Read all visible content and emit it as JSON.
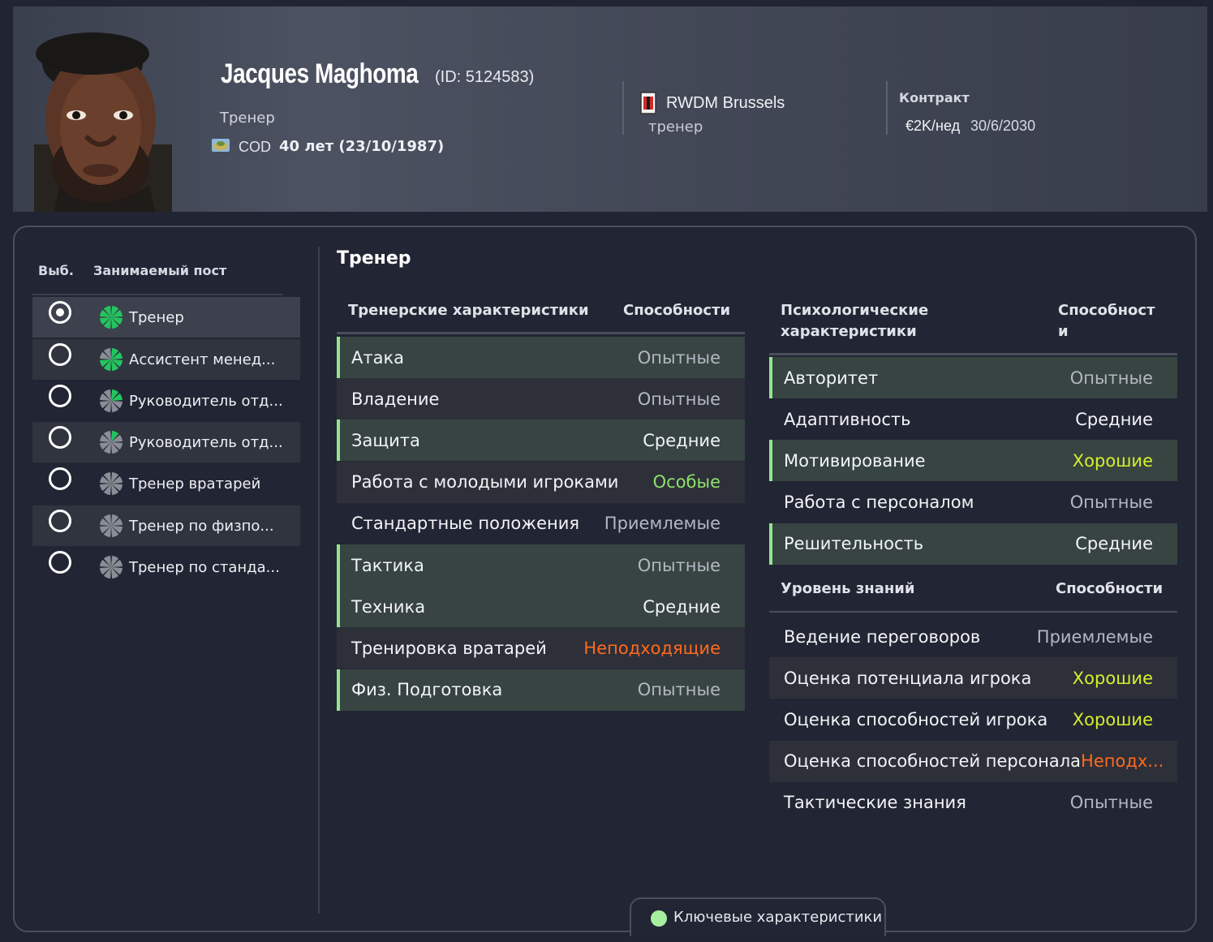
{
  "profile": {
    "name": "Jacques Maghoma",
    "id_text": "(ID: 5124583)",
    "role": "Тренер",
    "nationality": "COD",
    "age_dob": "40 лет (23/10/1987)"
  },
  "club": {
    "name": "RWDM Brussels",
    "role": "тренер"
  },
  "contract": {
    "label": "Контракт",
    "wage": "€2K/нед",
    "expiry": "30/6/2030"
  },
  "positions": {
    "header_select": "Выб.",
    "header_position": "Занимаемый пост",
    "items": [
      {
        "label": "Тренер",
        "selected": true,
        "icon": "role-pie-icon"
      },
      {
        "label": "Ассистент менед...",
        "selected": false,
        "icon": "role-pie-icon"
      },
      {
        "label": "Руководитель отд...",
        "selected": false,
        "icon": "role-pie-icon"
      },
      {
        "label": "Руководитель отд...",
        "selected": false,
        "icon": "role-pie-icon"
      },
      {
        "label": "Тренер вратарей",
        "selected": false,
        "icon": "role-pie-icon"
      },
      {
        "label": "Тренер по физпо...",
        "selected": false,
        "icon": "role-pie-icon"
      },
      {
        "label": "Тренер по станда...",
        "selected": false,
        "icon": "role-pie-icon"
      }
    ]
  },
  "section_title": "Тренер",
  "coaching": {
    "header_attr": "Тренерские характеристики",
    "header_ability": "Способности",
    "rows": [
      {
        "label": "Атака",
        "value": "Опытные",
        "key": true
      },
      {
        "label": "Владение",
        "value": "Опытные",
        "key": false
      },
      {
        "label": "Защита",
        "value": "Средние",
        "key": true
      },
      {
        "label": "Работа с молодыми игроками",
        "value": "Особые",
        "key": false
      },
      {
        "label": "Стандартные положения",
        "value": "Приемлемые",
        "key": false
      },
      {
        "label": "Тактика",
        "value": "Опытные",
        "key": true
      },
      {
        "label": "Техника",
        "value": "Средние",
        "key": true
      },
      {
        "label": "Тренировка вратарей",
        "value": "Неподходящие",
        "key": false
      },
      {
        "label": "Физ. Подготовка",
        "value": "Опытные",
        "key": true
      }
    ]
  },
  "mental": {
    "header_attr_line1": "Психологические",
    "header_attr_line2": "характеристики",
    "header_ability_line1": "Способност",
    "header_ability_line2": "и",
    "rows": [
      {
        "label": "Авторитет",
        "value": "Опытные",
        "key": true
      },
      {
        "label": "Адаптивность",
        "value": "Средние",
        "key": false
      },
      {
        "label": "Мотивирование",
        "value": "Хорошие",
        "key": true
      },
      {
        "label": "Работа с персоналом",
        "value": "Опытные",
        "key": false
      },
      {
        "label": "Решительность",
        "value": "Средние",
        "key": true
      }
    ]
  },
  "knowledge": {
    "header_attr": "Уровень знаний",
    "header_ability": "Способности",
    "rows": [
      {
        "label": "Ведение переговоров",
        "value": "Приемлемые",
        "key": false
      },
      {
        "label": "Оценка потенциала игрока",
        "value": "Хорошие",
        "key": false
      },
      {
        "label": "Оценка способностей игрока",
        "value": "Хорошие",
        "key": false
      },
      {
        "label": "Оценка способностей персонала",
        "value": "Неподх...",
        "key": false
      },
      {
        "label": "Тактические знания",
        "value": "Опытные",
        "key": false
      }
    ]
  },
  "legend": {
    "label": "Ключевые характеристики",
    "color": "#a6ef9e"
  },
  "value_colors": {
    "Опытные": "#b4b8c2",
    "Средние": "#f2f4f7",
    "Особые": "#8fe16a",
    "Приемлемые": "#b4b8c2",
    "Неподходящие": "#ff6a1f",
    "Неподх...": "#ff6a1f",
    "Хорошие": "#d4ef2c"
  }
}
